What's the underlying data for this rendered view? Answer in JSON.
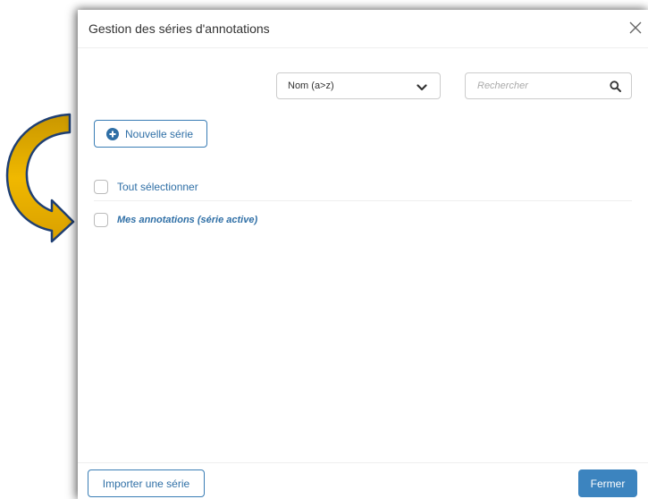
{
  "dialog": {
    "title": "Gestion des séries d'annotations",
    "close_icon": "close-icon"
  },
  "toolbar": {
    "sort_value": "Nom (a>z)",
    "sort_icon": "chevron-down-icon",
    "search_placeholder": "Rechercher",
    "search_value": "",
    "search_icon": "search-icon"
  },
  "new_series": {
    "label": "Nouvelle série",
    "icon": "plus-circle-icon"
  },
  "list": {
    "select_all_label": "Tout sélectionner",
    "items": [
      {
        "label": "Mes annotations (série active)",
        "checked": false
      }
    ]
  },
  "footer": {
    "import_label": "Importer une série",
    "close_label": "Fermer"
  },
  "colors": {
    "accent": "#2f6fa6",
    "primary_button": "#3c84bf",
    "arrow_fill": "#d9a400",
    "arrow_stroke": "#1f3f73"
  }
}
